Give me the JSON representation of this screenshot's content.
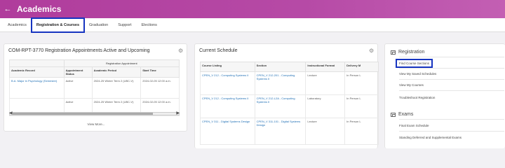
{
  "header": {
    "back_icon": "back-arrow-icon",
    "title": "Academics"
  },
  "tabs": [
    "Academics",
    "Registration & Courses",
    "Graduation",
    "Support",
    "Elections"
  ],
  "appointments": {
    "title": "COM-RPT-3770 Registration Appointments Active and Upcoming",
    "group_header": "Registration Appointment",
    "columns": [
      "Academic Record",
      "Appointment Status",
      "Academic Period",
      "Start Time"
    ],
    "rows": [
      [
        "B.A. Major in Psychology (Semester)",
        "Active",
        "2024-25 Winter Term 2 (UBC-V)",
        "2024-02-05 12:00 a.m."
      ],
      [
        "",
        "Active",
        "2024-25 Winter Term 2 (UBC-V)",
        "2024-02-05 12:00 a.m."
      ]
    ],
    "view_more": "View More..."
  },
  "schedule": {
    "title": "Current Schedule",
    "columns": [
      "Course Listing",
      "Section",
      "Instructional Format",
      "Delivery M"
    ],
    "rows": [
      [
        "CPEN_V 212 - Computing Systems II",
        "CPEN_V 212-201 - Computing Systems II",
        "Lecture",
        "In Person L"
      ],
      [
        "CPEN_V 212 - Computing Systems II",
        "CPEN_V 212-L2A - Computing Systems II",
        "Laboratory",
        "In Person L"
      ],
      [
        "CPEN_V 311 - Digital Systems Design",
        "CPEN_V 311-101 - Digital Systems Design",
        "Lecture",
        "In Person L"
      ]
    ]
  },
  "registration": {
    "heading": "Registration",
    "links": [
      "Find Course Sections",
      "View My Saved Schedules",
      "View My Courses",
      "Troubleshoot Registration"
    ]
  },
  "exams": {
    "heading": "Exams",
    "links": [
      "Final Exam Schedule",
      "Standing Deferred and Supplemental Exams"
    ]
  },
  "colors": {
    "brand": "#b03c9c",
    "highlight": "#1634c0",
    "link": "#1f6fb5"
  }
}
